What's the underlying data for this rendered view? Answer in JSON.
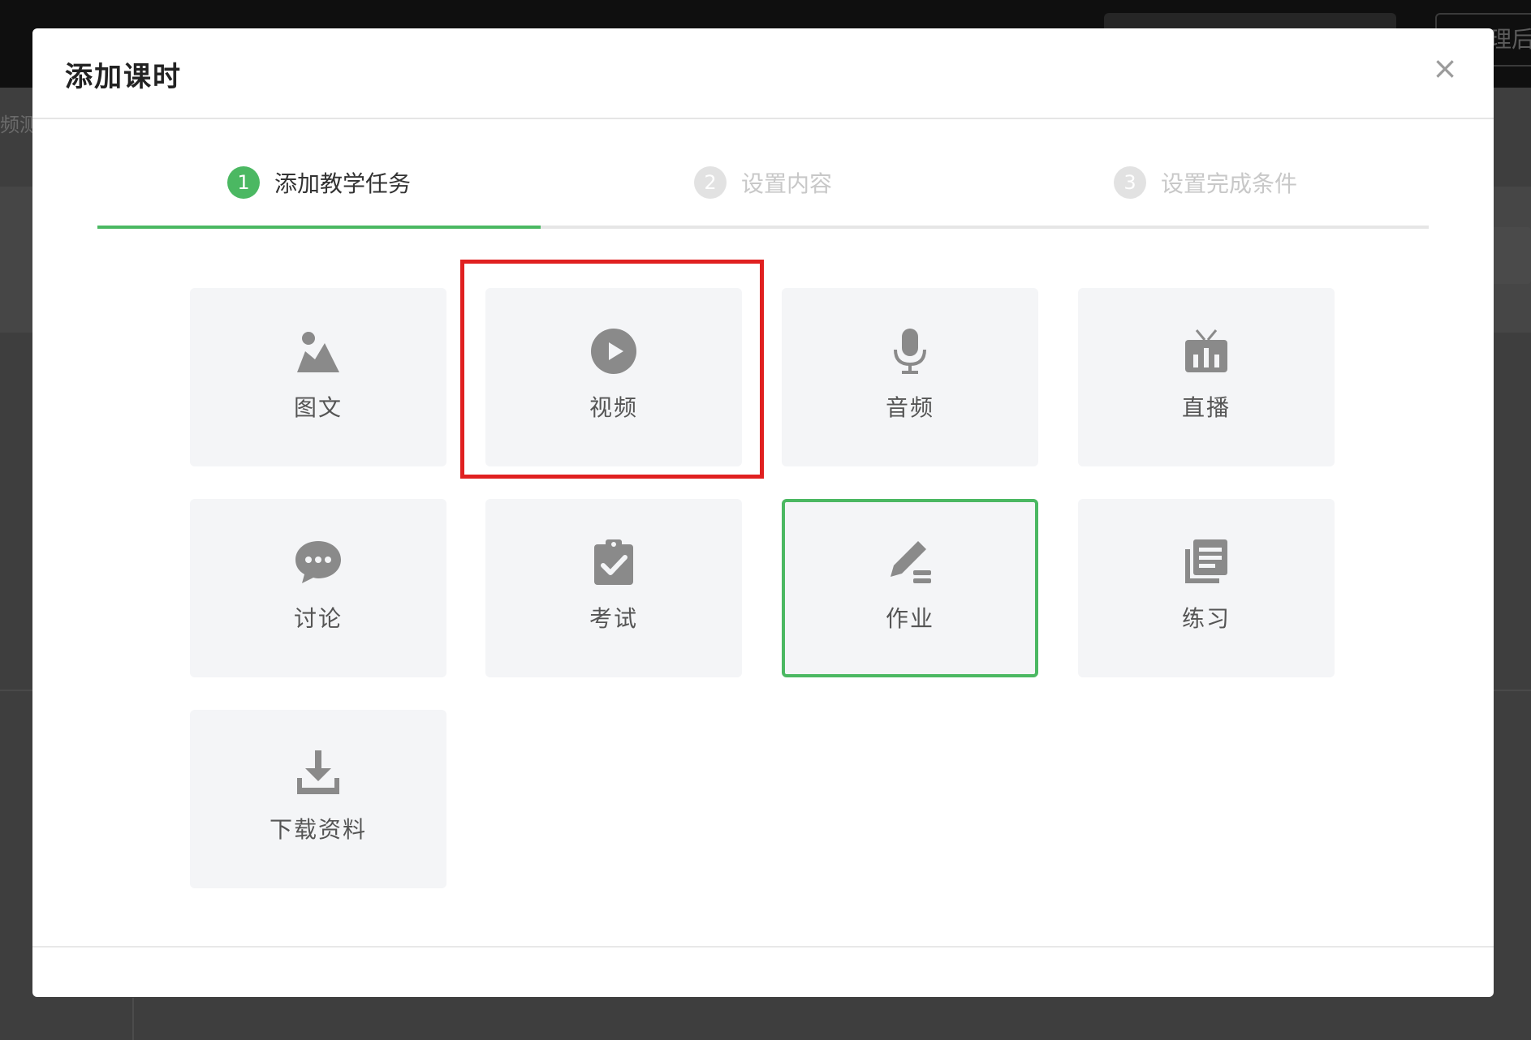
{
  "background": {
    "header_button": "理后台",
    "breadcrumb": "频测"
  },
  "modal": {
    "title": "添加课时",
    "close": "×"
  },
  "steps": [
    {
      "num": "1",
      "label": "添加教学任务",
      "state": "active"
    },
    {
      "num": "2",
      "label": "设置内容",
      "state": "inactive"
    },
    {
      "num": "3",
      "label": "设置完成条件",
      "state": "inactive"
    }
  ],
  "task_types": [
    {
      "label": "图文",
      "icon": "image-text-icon"
    },
    {
      "label": "视频",
      "icon": "video-play-icon"
    },
    {
      "label": "音频",
      "icon": "microphone-icon"
    },
    {
      "label": "直播",
      "icon": "tv-live-icon"
    },
    {
      "label": "讨论",
      "icon": "chat-bubble-icon"
    },
    {
      "label": "考试",
      "icon": "clipboard-check-icon"
    },
    {
      "label": "作业",
      "icon": "pen-edit-icon",
      "selected": true
    },
    {
      "label": "练习",
      "icon": "list-document-icon"
    },
    {
      "label": "下载资料",
      "icon": "download-icon"
    }
  ],
  "colors": {
    "accent": "#4bb862",
    "annotation": "#e02020",
    "card_bg": "#f4f5f7",
    "icon": "#8a8a8a"
  }
}
